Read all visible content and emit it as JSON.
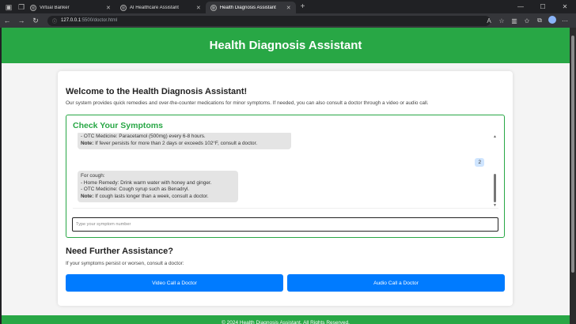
{
  "browser": {
    "tabs": [
      {
        "label": "Virtual Banker",
        "active": false
      },
      {
        "label": "AI Healthcare Assistant",
        "active": false
      },
      {
        "label": "Health Diagnosis Assistant",
        "active": true
      }
    ],
    "address": {
      "host": "127.0.0.1",
      "path": ":5500/doctor.html"
    },
    "colors": {
      "chrome": "#202124",
      "toolbar": "#35363a"
    }
  },
  "page": {
    "header_title": "Health Diagnosis Assistant",
    "welcome_title": "Welcome to the Health Diagnosis Assistant!",
    "welcome_text": "Our system provides quick remedies and over-the-counter medications for minor symptoms. If needed, you can also consult a doctor through a video or audio call.",
    "symptoms_title": "Check Your Symptoms",
    "chat": [
      {
        "role": "bot",
        "lines": [
          "- OTC Medicine: Paracetamol (500mg) every 6-8 hours."
        ],
        "note_label": "Note:",
        "note": " If fever persists for more than 2 days or exceeds 102°F, consult a doctor."
      },
      {
        "role": "user",
        "text": "2"
      },
      {
        "role": "bot",
        "lines": [
          "For cough:",
          "- Home Remedy: Drink warm water with honey and ginger.",
          "- OTC Medicine: Cough syrup such as Benadryl."
        ],
        "note_label": "Note:",
        "note": " If cough lasts longer than a week, consult a doctor."
      }
    ],
    "input_placeholder": "Type your symptom number",
    "assist_title": "Need Further Assistance?",
    "assist_text": "If your symptoms persist or worsen, consult a doctor:",
    "video_button": "Video Call a Doctor",
    "audio_button": "Audio Call a Doctor",
    "footer": "© 2024 Health Diagnosis Assistant. All Rights Reserved.",
    "colors": {
      "primary_green": "#28a745",
      "button_blue": "#007bff",
      "bot_bubble": "#e4e4e4",
      "user_bubble": "#cfe5ff"
    }
  }
}
